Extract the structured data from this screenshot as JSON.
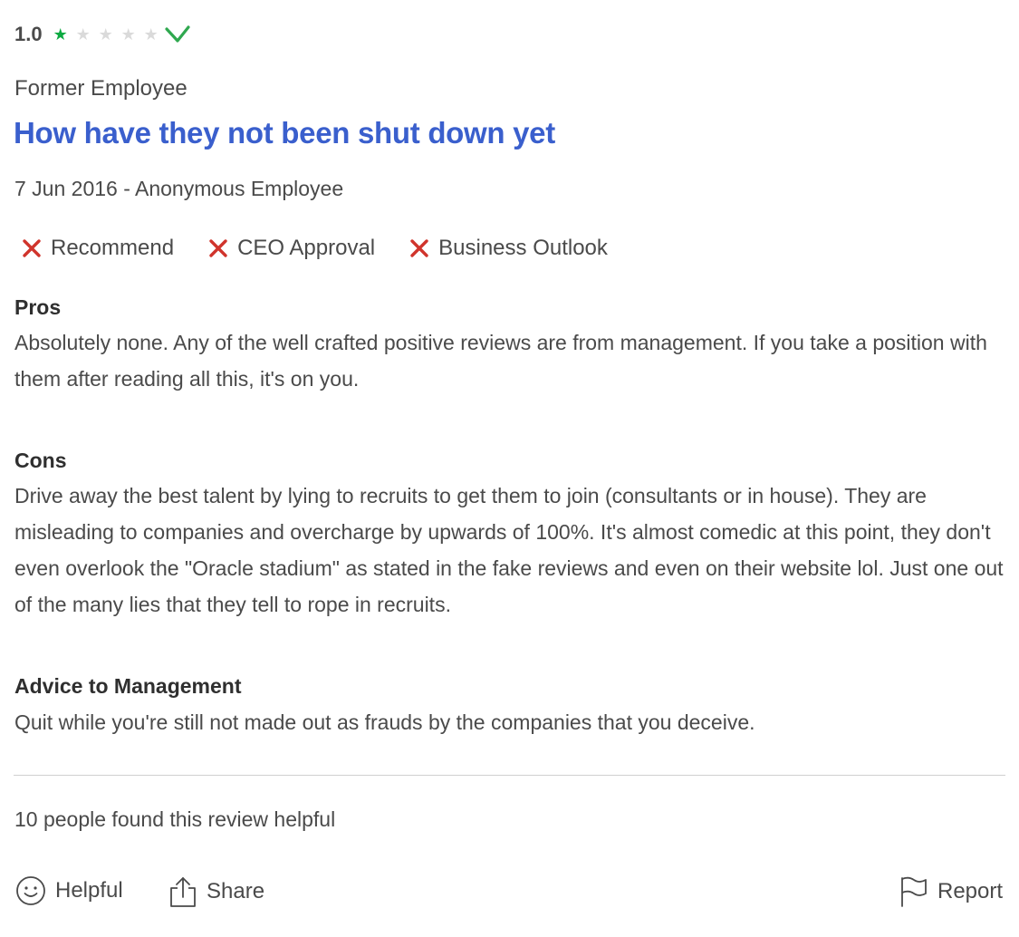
{
  "rating": {
    "value": "1.0",
    "stars_filled": 1,
    "stars_total": 5,
    "check_icon": "checkmark-icon",
    "star_color": "#0caa41",
    "check_color": "#0caa41"
  },
  "review": {
    "employee_status": "Former Employee",
    "title": "How have they not been shut down yet",
    "meta": "7 Jun 2016 - Anonymous Employee",
    "title_color": "#3a5fcd"
  },
  "badges": [
    {
      "icon": "x-icon",
      "label": "Recommend"
    },
    {
      "icon": "x-icon",
      "label": "CEO Approval"
    },
    {
      "icon": "x-icon",
      "label": "Business Outlook"
    }
  ],
  "badge_icon_color": "#d0342c",
  "sections": {
    "pros": {
      "heading": "Pros",
      "body": "Absolutely none. Any of the well crafted positive reviews are from management. If you take a position with them after reading all this, it's on you."
    },
    "cons": {
      "heading": "Cons",
      "body": "Drive away the best talent by lying to recruits to get them to join (consultants or in house). They are misleading to companies and overcharge by upwards of 100%. It's almost comedic at this point, they don't even overlook the \"Oracle stadium\" as stated in the fake reviews and even on their website lol. Just one out of the many lies that they tell to rope in recruits."
    },
    "advice": {
      "heading": "Advice to Management",
      "body": "Quit while you're still not made out as frauds by the companies that you deceive."
    }
  },
  "footer": {
    "helpful_count": "10 people found this review helpful",
    "helpful_label": "Helpful",
    "helpful_icon": "smiley-face-icon",
    "share_label": "Share",
    "share_icon": "share-icon",
    "report_label": "Report",
    "report_icon": "flag-icon"
  }
}
